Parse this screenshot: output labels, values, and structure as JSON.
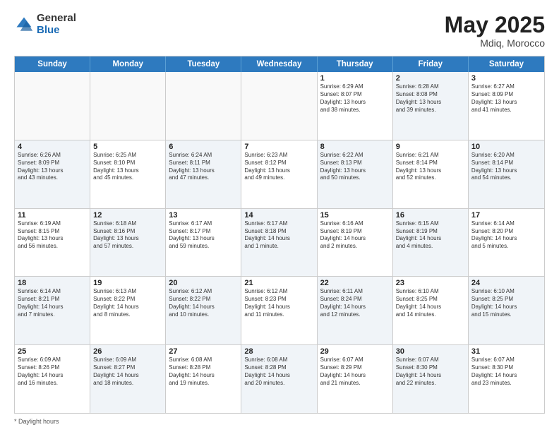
{
  "logo": {
    "general": "General",
    "blue": "Blue"
  },
  "title": {
    "month": "May 2025",
    "location": "Mdiq, Morocco"
  },
  "header_days": [
    "Sunday",
    "Monday",
    "Tuesday",
    "Wednesday",
    "Thursday",
    "Friday",
    "Saturday"
  ],
  "footnote": "Daylight hours",
  "weeks": [
    [
      {
        "day": "",
        "info": "",
        "shaded": false,
        "empty": true
      },
      {
        "day": "",
        "info": "",
        "shaded": false,
        "empty": true
      },
      {
        "day": "",
        "info": "",
        "shaded": false,
        "empty": true
      },
      {
        "day": "",
        "info": "",
        "shaded": false,
        "empty": true
      },
      {
        "day": "1",
        "info": "Sunrise: 6:29 AM\nSunset: 8:07 PM\nDaylight: 13 hours\nand 38 minutes.",
        "shaded": false,
        "empty": false
      },
      {
        "day": "2",
        "info": "Sunrise: 6:28 AM\nSunset: 8:08 PM\nDaylight: 13 hours\nand 39 minutes.",
        "shaded": true,
        "empty": false
      },
      {
        "day": "3",
        "info": "Sunrise: 6:27 AM\nSunset: 8:09 PM\nDaylight: 13 hours\nand 41 minutes.",
        "shaded": false,
        "empty": false
      }
    ],
    [
      {
        "day": "4",
        "info": "Sunrise: 6:26 AM\nSunset: 8:09 PM\nDaylight: 13 hours\nand 43 minutes.",
        "shaded": true,
        "empty": false
      },
      {
        "day": "5",
        "info": "Sunrise: 6:25 AM\nSunset: 8:10 PM\nDaylight: 13 hours\nand 45 minutes.",
        "shaded": false,
        "empty": false
      },
      {
        "day": "6",
        "info": "Sunrise: 6:24 AM\nSunset: 8:11 PM\nDaylight: 13 hours\nand 47 minutes.",
        "shaded": true,
        "empty": false
      },
      {
        "day": "7",
        "info": "Sunrise: 6:23 AM\nSunset: 8:12 PM\nDaylight: 13 hours\nand 49 minutes.",
        "shaded": false,
        "empty": false
      },
      {
        "day": "8",
        "info": "Sunrise: 6:22 AM\nSunset: 8:13 PM\nDaylight: 13 hours\nand 50 minutes.",
        "shaded": true,
        "empty": false
      },
      {
        "day": "9",
        "info": "Sunrise: 6:21 AM\nSunset: 8:14 PM\nDaylight: 13 hours\nand 52 minutes.",
        "shaded": false,
        "empty": false
      },
      {
        "day": "10",
        "info": "Sunrise: 6:20 AM\nSunset: 8:14 PM\nDaylight: 13 hours\nand 54 minutes.",
        "shaded": true,
        "empty": false
      }
    ],
    [
      {
        "day": "11",
        "info": "Sunrise: 6:19 AM\nSunset: 8:15 PM\nDaylight: 13 hours\nand 56 minutes.",
        "shaded": false,
        "empty": false
      },
      {
        "day": "12",
        "info": "Sunrise: 6:18 AM\nSunset: 8:16 PM\nDaylight: 13 hours\nand 57 minutes.",
        "shaded": true,
        "empty": false
      },
      {
        "day": "13",
        "info": "Sunrise: 6:17 AM\nSunset: 8:17 PM\nDaylight: 13 hours\nand 59 minutes.",
        "shaded": false,
        "empty": false
      },
      {
        "day": "14",
        "info": "Sunrise: 6:17 AM\nSunset: 8:18 PM\nDaylight: 14 hours\nand 1 minute.",
        "shaded": true,
        "empty": false
      },
      {
        "day": "15",
        "info": "Sunrise: 6:16 AM\nSunset: 8:19 PM\nDaylight: 14 hours\nand 2 minutes.",
        "shaded": false,
        "empty": false
      },
      {
        "day": "16",
        "info": "Sunrise: 6:15 AM\nSunset: 8:19 PM\nDaylight: 14 hours\nand 4 minutes.",
        "shaded": true,
        "empty": false
      },
      {
        "day": "17",
        "info": "Sunrise: 6:14 AM\nSunset: 8:20 PM\nDaylight: 14 hours\nand 5 minutes.",
        "shaded": false,
        "empty": false
      }
    ],
    [
      {
        "day": "18",
        "info": "Sunrise: 6:14 AM\nSunset: 8:21 PM\nDaylight: 14 hours\nand 7 minutes.",
        "shaded": true,
        "empty": false
      },
      {
        "day": "19",
        "info": "Sunrise: 6:13 AM\nSunset: 8:22 PM\nDaylight: 14 hours\nand 8 minutes.",
        "shaded": false,
        "empty": false
      },
      {
        "day": "20",
        "info": "Sunrise: 6:12 AM\nSunset: 8:22 PM\nDaylight: 14 hours\nand 10 minutes.",
        "shaded": true,
        "empty": false
      },
      {
        "day": "21",
        "info": "Sunrise: 6:12 AM\nSunset: 8:23 PM\nDaylight: 14 hours\nand 11 minutes.",
        "shaded": false,
        "empty": false
      },
      {
        "day": "22",
        "info": "Sunrise: 6:11 AM\nSunset: 8:24 PM\nDaylight: 14 hours\nand 12 minutes.",
        "shaded": true,
        "empty": false
      },
      {
        "day": "23",
        "info": "Sunrise: 6:10 AM\nSunset: 8:25 PM\nDaylight: 14 hours\nand 14 minutes.",
        "shaded": false,
        "empty": false
      },
      {
        "day": "24",
        "info": "Sunrise: 6:10 AM\nSunset: 8:25 PM\nDaylight: 14 hours\nand 15 minutes.",
        "shaded": true,
        "empty": false
      }
    ],
    [
      {
        "day": "25",
        "info": "Sunrise: 6:09 AM\nSunset: 8:26 PM\nDaylight: 14 hours\nand 16 minutes.",
        "shaded": false,
        "empty": false
      },
      {
        "day": "26",
        "info": "Sunrise: 6:09 AM\nSunset: 8:27 PM\nDaylight: 14 hours\nand 18 minutes.",
        "shaded": true,
        "empty": false
      },
      {
        "day": "27",
        "info": "Sunrise: 6:08 AM\nSunset: 8:28 PM\nDaylight: 14 hours\nand 19 minutes.",
        "shaded": false,
        "empty": false
      },
      {
        "day": "28",
        "info": "Sunrise: 6:08 AM\nSunset: 8:28 PM\nDaylight: 14 hours\nand 20 minutes.",
        "shaded": true,
        "empty": false
      },
      {
        "day": "29",
        "info": "Sunrise: 6:07 AM\nSunset: 8:29 PM\nDaylight: 14 hours\nand 21 minutes.",
        "shaded": false,
        "empty": false
      },
      {
        "day": "30",
        "info": "Sunrise: 6:07 AM\nSunset: 8:30 PM\nDaylight: 14 hours\nand 22 minutes.",
        "shaded": true,
        "empty": false
      },
      {
        "day": "31",
        "info": "Sunrise: 6:07 AM\nSunset: 8:30 PM\nDaylight: 14 hours\nand 23 minutes.",
        "shaded": false,
        "empty": false
      }
    ]
  ]
}
